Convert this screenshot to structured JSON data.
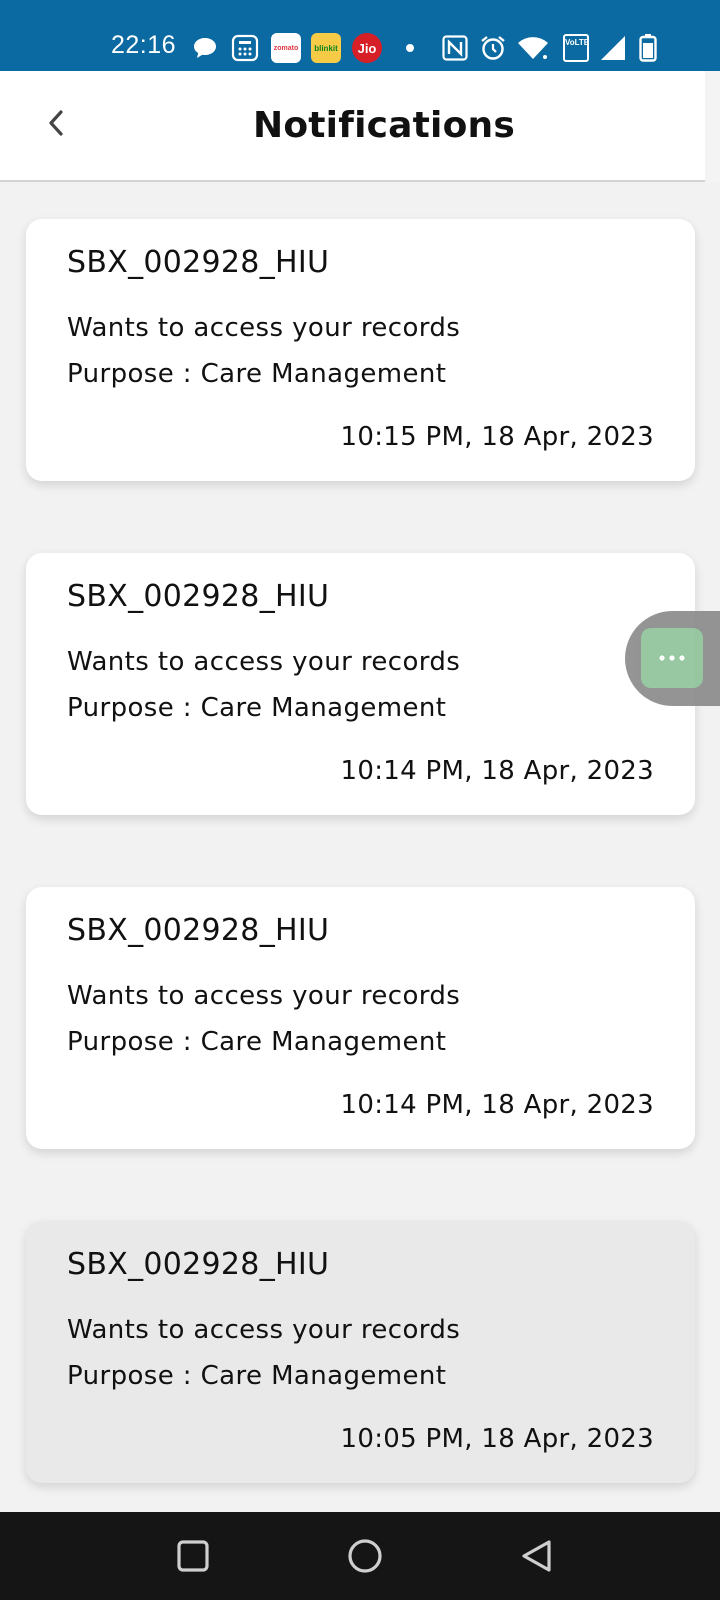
{
  "status_bar": {
    "time": "22:16",
    "apps": [
      {
        "name": "chat-bubble-icon"
      },
      {
        "name": "calculator-icon"
      },
      {
        "name": "zomato-icon",
        "label": "zomato",
        "bg": "#ffffff",
        "fg": "#e23744"
      },
      {
        "name": "blinkit-icon",
        "label": "blinkit",
        "bg": "#f8cb46",
        "fg": "#0c831f"
      },
      {
        "name": "jio-icon",
        "label": "Jio",
        "bg": "#d61f26",
        "fg": "#ffffff"
      }
    ],
    "volte_label": "VoLTE",
    "colors": {
      "background": "#0a6aa1",
      "foreground": "#ffffff"
    }
  },
  "header": {
    "title": "Notifications",
    "back_icon": "chevron-left-icon"
  },
  "notifications": [
    {
      "requester": "SBX_002928_HIU",
      "message": "Wants to access your records",
      "purpose": "Purpose : Care Management",
      "timestamp": "10:15 PM, 18 Apr, 2023",
      "state": "normal"
    },
    {
      "requester": "SBX_002928_HIU",
      "message": "Wants to access your records",
      "purpose": "Purpose : Care Management",
      "timestamp": "10:14 PM, 18 Apr, 2023",
      "state": "normal"
    },
    {
      "requester": "SBX_002928_HIU",
      "message": "Wants to access your records",
      "purpose": "Purpose : Care Management",
      "timestamp": "10:14 PM, 18 Apr, 2023",
      "state": "normal"
    },
    {
      "requester": "SBX_002928_HIU",
      "message": "Wants to access your records",
      "purpose": "Purpose : Care Management",
      "timestamp": "10:05 PM, 18 Apr, 2023",
      "state": "pressed"
    }
  ],
  "floating_button": {
    "icon": "more-dots-icon",
    "color": "#8fc49a"
  },
  "nav_bar": {
    "icons": [
      "recent-apps-icon",
      "home-icon",
      "back-icon"
    ]
  }
}
